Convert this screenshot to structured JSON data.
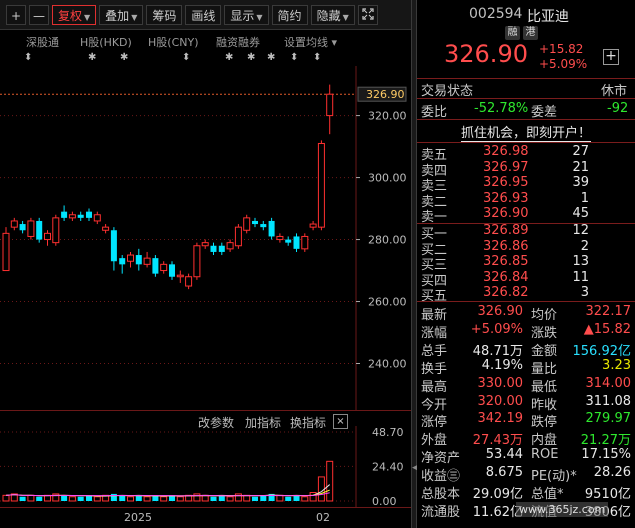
{
  "toolbar": {
    "plus": "+",
    "minus": "—",
    "items": [
      "复权",
      "叠加",
      "筹码",
      "画线",
      "显示",
      "简约",
      "隐藏"
    ],
    "expand_icon": "expand-icon"
  },
  "subbar": {
    "items": [
      "深股通",
      "H股(HKD)",
      "H股(CNY)",
      "融资融券",
      "设置均线"
    ]
  },
  "markers": [
    "⬍",
    "✱",
    "✱",
    "⬍",
    "✱",
    "✱",
    "✱",
    "⬍",
    "⬍"
  ],
  "price_axis": [
    "326.90",
    "320.00",
    "300.00",
    "280.00",
    "260.00",
    "240.00"
  ],
  "volume_header": {
    "items": [
      "改参数",
      "加指标",
      "换指标"
    ],
    "close": "×"
  },
  "volume_axis": [
    "48.70",
    "24.40",
    "0.00"
  ],
  "time_axis": [
    "2025",
    "02"
  ],
  "chart_data": {
    "type": "candlestick",
    "ylim": [
      225,
      336
    ],
    "last_price": 326.9,
    "candles": [
      {
        "o": 270,
        "c": 282,
        "h": 284,
        "l": 270,
        "up": true
      },
      {
        "o": 284,
        "c": 286,
        "h": 287,
        "l": 283,
        "up": true
      },
      {
        "o": 283,
        "c": 285,
        "h": 286,
        "l": 282,
        "up": false
      },
      {
        "o": 281,
        "c": 286,
        "h": 287,
        "l": 280,
        "up": true
      },
      {
        "o": 286,
        "c": 280,
        "h": 287,
        "l": 279,
        "up": false
      },
      {
        "o": 280,
        "c": 282,
        "h": 283,
        "l": 278,
        "up": true
      },
      {
        "o": 279,
        "c": 287,
        "h": 288,
        "l": 278,
        "up": true
      },
      {
        "o": 289,
        "c": 287,
        "h": 291,
        "l": 286,
        "up": false
      },
      {
        "o": 287,
        "c": 288,
        "h": 289,
        "l": 286,
        "up": true
      },
      {
        "o": 288,
        "c": 287,
        "h": 289,
        "l": 286,
        "up": false
      },
      {
        "o": 287,
        "c": 289,
        "h": 290,
        "l": 286,
        "up": false
      },
      {
        "o": 288,
        "c": 286,
        "h": 289,
        "l": 285,
        "up": true
      },
      {
        "o": 283,
        "c": 284,
        "h": 285,
        "l": 282,
        "up": true
      },
      {
        "o": 283,
        "c": 273,
        "h": 284,
        "l": 270,
        "up": false
      },
      {
        "o": 274,
        "c": 272,
        "h": 275,
        "l": 269,
        "up": false
      },
      {
        "o": 273,
        "c": 275,
        "h": 276,
        "l": 271,
        "up": true
      },
      {
        "o": 275,
        "c": 272,
        "h": 277,
        "l": 270,
        "up": false
      },
      {
        "o": 272,
        "c": 274,
        "h": 276,
        "l": 271,
        "up": true
      },
      {
        "o": 274,
        "c": 269,
        "h": 275,
        "l": 268,
        "up": false
      },
      {
        "o": 270,
        "c": 272,
        "h": 273,
        "l": 269,
        "up": true
      },
      {
        "o": 272,
        "c": 268,
        "h": 273,
        "l": 267,
        "up": false
      },
      {
        "o": 268,
        "c": 268.5,
        "h": 270,
        "l": 266,
        "up": true
      },
      {
        "o": 265,
        "c": 268,
        "h": 269,
        "l": 264,
        "up": true
      },
      {
        "o": 268,
        "c": 278,
        "h": 279,
        "l": 267,
        "up": true
      },
      {
        "o": 279,
        "c": 278,
        "h": 280,
        "l": 277,
        "up": true
      },
      {
        "o": 278,
        "c": 276,
        "h": 279,
        "l": 275,
        "up": false
      },
      {
        "o": 276,
        "c": 278,
        "h": 279,
        "l": 275,
        "up": false
      },
      {
        "o": 277,
        "c": 279,
        "h": 280,
        "l": 276,
        "up": true
      },
      {
        "o": 278,
        "c": 284,
        "h": 285,
        "l": 277,
        "up": true
      },
      {
        "o": 283,
        "c": 287,
        "h": 288,
        "l": 282,
        "up": true
      },
      {
        "o": 286,
        "c": 285,
        "h": 287,
        "l": 284,
        "up": false
      },
      {
        "o": 285,
        "c": 284,
        "h": 286,
        "l": 283,
        "up": false
      },
      {
        "o": 286,
        "c": 281,
        "h": 287,
        "l": 280,
        "up": false
      },
      {
        "o": 281,
        "c": 280,
        "h": 282,
        "l": 279,
        "up": true
      },
      {
        "o": 280,
        "c": 279,
        "h": 281,
        "l": 278,
        "up": false
      },
      {
        "o": 281,
        "c": 277,
        "h": 282,
        "l": 276,
        "up": false
      },
      {
        "o": 277,
        "c": 281,
        "h": 282,
        "l": 276,
        "up": true
      },
      {
        "o": 284,
        "c": 285,
        "h": 286,
        "l": 283,
        "up": true
      },
      {
        "o": 284,
        "c": 311,
        "h": 312,
        "l": 283,
        "up": true
      },
      {
        "o": 320,
        "c": 326.9,
        "h": 330,
        "l": 314,
        "up": true
      }
    ],
    "volumes": [
      4,
      5,
      3,
      4,
      3,
      4,
      5,
      4,
      3,
      3,
      4,
      3,
      4,
      5,
      4,
      3,
      4,
      3,
      4,
      3,
      4,
      3,
      4,
      5,
      4,
      3,
      4,
      3,
      5,
      4,
      3,
      4,
      5,
      4,
      3,
      4,
      3,
      6,
      17,
      28
    ]
  },
  "quote": {
    "code": "002594",
    "name": "比亚迪",
    "tag1": "融",
    "tag2": "港",
    "price": "326.90",
    "change": "+15.82",
    "pct": "+5.09%",
    "plus": "+"
  },
  "status": {
    "label": "交易状态",
    "value": "休市"
  },
  "ratio": {
    "l1": "委比",
    "v1": "-52.78%",
    "l2": "委差",
    "v2": "-92"
  },
  "banner": "抓住机会，即刻开户！",
  "asks": [
    {
      "label": "卖五",
      "price": "326.98",
      "vol": "27"
    },
    {
      "label": "卖四",
      "price": "326.97",
      "vol": "21"
    },
    {
      "label": "卖三",
      "price": "326.95",
      "vol": "39"
    },
    {
      "label": "卖二",
      "price": "326.93",
      "vol": "1"
    },
    {
      "label": "卖一",
      "price": "326.90",
      "vol": "45"
    }
  ],
  "bids": [
    {
      "label": "买一",
      "price": "326.89",
      "vol": "12"
    },
    {
      "label": "买二",
      "price": "326.86",
      "vol": "2"
    },
    {
      "label": "买三",
      "price": "326.85",
      "vol": "13"
    },
    {
      "label": "买四",
      "price": "326.84",
      "vol": "11"
    },
    {
      "label": "买五",
      "price": "326.82",
      "vol": "3"
    }
  ],
  "stats": [
    {
      "l1": "最新",
      "v1": "326.90",
      "c1": "red",
      "l2": "均价",
      "v2": "322.17",
      "c2": "red"
    },
    {
      "l1": "涨幅",
      "v1": "+5.09%",
      "c1": "red",
      "l2": "涨跌",
      "v2": "▲15.82",
      "c2": "red"
    },
    {
      "l1": "总手",
      "v1": "48.71万",
      "c1": "white",
      "l2": "金额",
      "v2": "156.92亿",
      "c2": "cyan"
    },
    {
      "l1": "换手",
      "v1": "4.19%",
      "c1": "white",
      "l2": "量比",
      "v2": "3.23",
      "c2": "yellow"
    },
    {
      "l1": "最高",
      "v1": "330.00",
      "c1": "red",
      "l2": "最低",
      "v2": "314.00",
      "c2": "red"
    },
    {
      "l1": "今开",
      "v1": "320.00",
      "c1": "red",
      "l2": "昨收",
      "v2": "311.08",
      "c2": "white"
    },
    {
      "l1": "涨停",
      "v1": "342.19",
      "c1": "red",
      "l2": "跌停",
      "v2": "279.97",
      "c2": "green"
    },
    {
      "l1": "外盘",
      "v1": "27.43万",
      "c1": "red",
      "l2": "内盘",
      "v2": "21.27万",
      "c2": "green"
    },
    {
      "l1": "净资产",
      "v1": "53.44",
      "c1": "white",
      "l2": "ROE",
      "v2": "17.15%",
      "c2": "white"
    },
    {
      "l1": "收益㊂",
      "v1": "8.675",
      "c1": "white",
      "l2": "PE(动)*",
      "v2": "28.26",
      "c2": "white"
    },
    {
      "l1": "总股本",
      "v1": "29.09亿",
      "c1": "white",
      "l2": "总值*",
      "v2": "9510亿",
      "c2": "white"
    },
    {
      "l1": "流通股",
      "v1": "11.62亿",
      "c1": "white",
      "l2": "流值",
      "v2": "3806亿",
      "c2": "white"
    }
  ],
  "watermark": "www.365jz.com",
  "colors": {
    "up": "#ff3030",
    "down": "#00e5ff",
    "grid": "#6a1818",
    "dash": "#e05a2a"
  }
}
